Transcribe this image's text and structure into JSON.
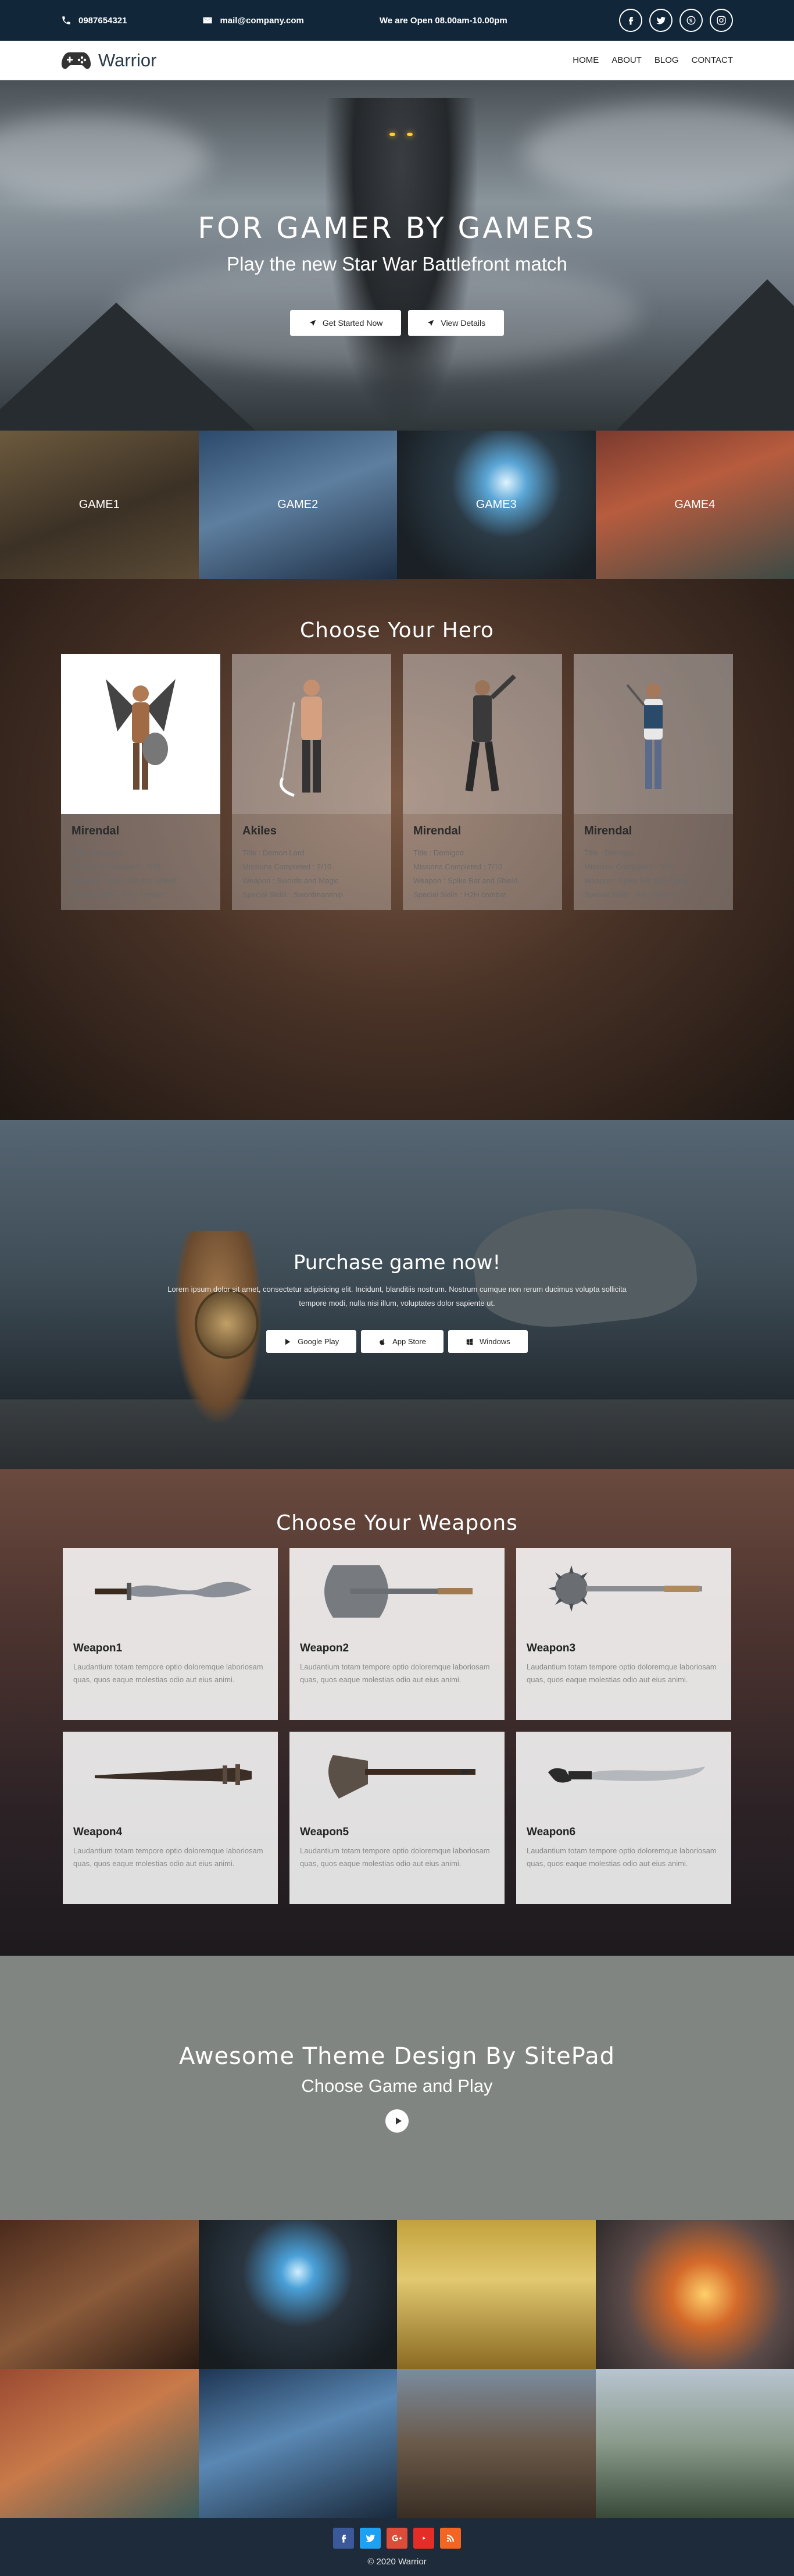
{
  "topbar": {
    "phone": "0987654321",
    "email": "mail@company.com",
    "hours": "We are Open 08.00am-10.00pm",
    "socials": [
      "facebook-icon",
      "twitter-icon",
      "skype-icon",
      "instagram-icon"
    ]
  },
  "nav": {
    "brand": "Warrior",
    "menu": [
      "HOME",
      "ABOUT",
      "BLOG",
      "CONTACT"
    ]
  },
  "hero": {
    "title": "FOR GAMER BY GAMERS",
    "subtitle": "Play the new Star War Battlefront match",
    "buttons": [
      "Get Started Now",
      "View Details"
    ]
  },
  "games": [
    "GAME1",
    "GAME2",
    "GAME3",
    "GAME4"
  ],
  "heroes": {
    "title": "Choose Your Hero",
    "cards": [
      {
        "name": "Mirendal",
        "lines": [
          "Title : Demigod",
          "Missions Completed : 7/10",
          "Weapon : Spike Bat and Shield",
          "Special Skills : H2H combat"
        ]
      },
      {
        "name": "Akiles",
        "lines": [
          "Title : Demon Lord",
          "Missions Completed : 2/10",
          "Weapon : Swords and Magic",
          "Special Skills : Swordmanship"
        ]
      },
      {
        "name": "Mirendal",
        "lines": [
          "Title : Demigod",
          "Missions Completed : 7/10",
          "Weapon : Spike Bat and Shield",
          "Special Skills : H2H combat"
        ]
      },
      {
        "name": "Mirendal",
        "lines": [
          "Title : Demigod",
          "Missions Completed : 7/10",
          "Weapon : Spike Bat and Shield",
          "Special Skills : H2H combat"
        ]
      }
    ]
  },
  "purchase": {
    "title": "Purchase game now!",
    "text": "Lorem ipsum dolor sit amet, consectetur adipisicing elit. Incidunt, blanditiis nostrum. Nostrum cumque non rerum ducimus volupta sollicita tempore modi, nulla nisi illum, voluptates dolor sapiente ut.",
    "buttons": [
      "Google Play",
      "App Store",
      "Windows"
    ]
  },
  "weapons": {
    "title": "Choose Your Weapons",
    "desc": "Laudantium totam tempore optio doloremque laboriosam quas, quos eaque molestias odio aut eius animi.",
    "items": [
      "Weapon1",
      "Weapon2",
      "Weapon3",
      "Weapon4",
      "Weapon5",
      "Weapon6"
    ]
  },
  "theme": {
    "title": "Awesome Theme Design By SitePad",
    "subtitle": "Choose Game and Play"
  },
  "footer": {
    "socials": [
      "facebook-icon",
      "twitter-icon",
      "google-plus-icon",
      "youtube-icon",
      "rss-icon"
    ],
    "social_colors": [
      "#3b5998",
      "#1da1f2",
      "#dd4b39",
      "#e52d27",
      "#f26522"
    ],
    "copyright": "© 2020 Warrior"
  }
}
